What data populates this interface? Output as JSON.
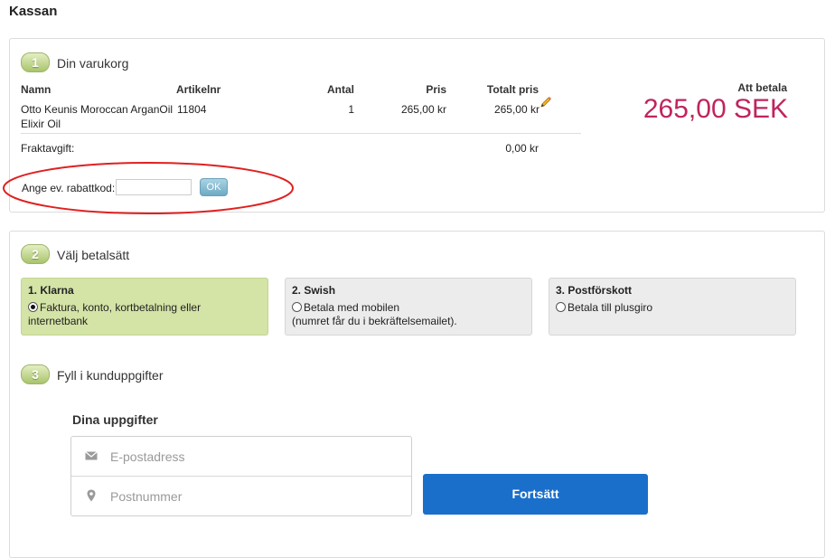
{
  "page": {
    "title": "Kassan"
  },
  "cart": {
    "step_number": "1",
    "title": "Din varukorg",
    "columns": {
      "name": "Namn",
      "article": "Artikelnr",
      "qty": "Antal",
      "price": "Pris",
      "total": "Totalt pris"
    },
    "items": [
      {
        "name_line1": "Otto Keunis Moroccan ArganOil",
        "name_line2": "Elixir Oil",
        "article": "11804",
        "qty": "1",
        "price": "265,00 kr",
        "total": "265,00 kr"
      }
    ],
    "shipping_label": "Fraktavgift:",
    "shipping_value": "0,00 kr",
    "discount_label": "Ange ev. rabattkod:",
    "discount_value": "",
    "ok_label": "OK",
    "pay_label": "Att betala",
    "pay_amount": "265,00 SEK",
    "pay_color": "#c0245e",
    "highlight_color": "#e02020"
  },
  "payment": {
    "step_number": "2",
    "title": "Välj betalsätt",
    "options": [
      {
        "title": "1. Klarna",
        "desc_line1": "Faktura, konto, kortbetalning eller",
        "desc_line2": "internetbank",
        "selected": true
      },
      {
        "title": "2. Swish",
        "desc_line1": "Betala med mobilen",
        "desc_line2": "(numret får du i bekräftelsemailet).",
        "selected": false
      },
      {
        "title": "3. Postförskott",
        "desc_line1": "Betala till plusgiro",
        "desc_line2": "",
        "selected": false
      }
    ]
  },
  "customer": {
    "step_number": "3",
    "title": "Fyll i kunduppgifter",
    "heading": "Dina uppgifter",
    "email_placeholder": "E-postadress",
    "email_icon": "envelope-icon",
    "postal_placeholder": "Postnummer",
    "postal_icon": "map-pin-icon",
    "continue_label": "Fortsätt",
    "continue_color": "#1a6fcb"
  }
}
